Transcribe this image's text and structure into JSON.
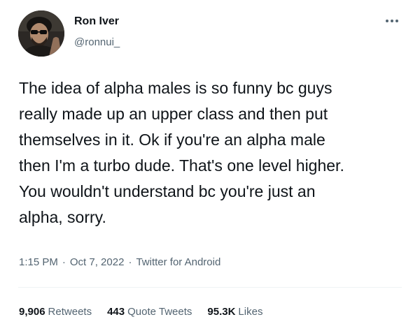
{
  "author": {
    "name": "Ron Iver",
    "handle": "@ronnui_"
  },
  "tweet": {
    "text": "The idea of alpha males is so funny bc guys\nreally made up an upper class and then put\nthemselves in it. Ok if you're an alpha male\nthen I'm a turbo dude. That's one level higher.\nYou wouldn't understand bc you're just an\nalpha, sorry.",
    "time": "1:15 PM",
    "date": "Oct 7, 2022",
    "source": "Twitter for Android",
    "separator": "·"
  },
  "stats": {
    "retweets": {
      "count": "9,906",
      "label": "Retweets"
    },
    "quotes": {
      "count": "443",
      "label": "Quote Tweets"
    },
    "likes": {
      "count": "95.3K",
      "label": "Likes"
    }
  },
  "icons": {
    "more": "more-horizontal-icon",
    "avatar": "profile-photo"
  },
  "colors": {
    "text_primary": "#0f1419",
    "text_secondary": "#536471",
    "divider": "#eff3f4"
  }
}
